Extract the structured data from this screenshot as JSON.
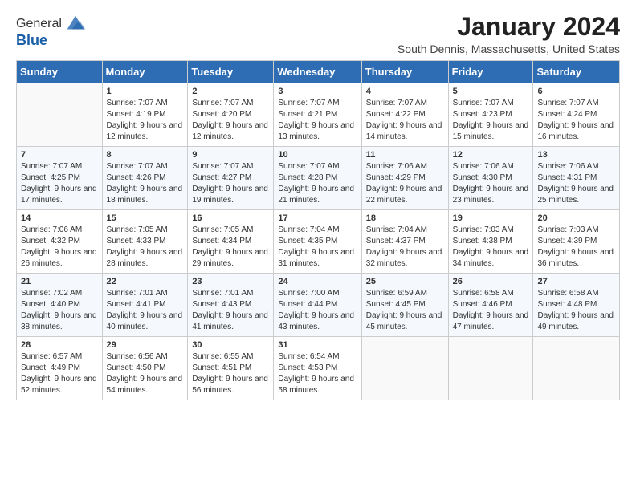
{
  "header": {
    "logo_line1": "General",
    "logo_line2": "Blue",
    "month_year": "January 2024",
    "location": "South Dennis, Massachusetts, United States"
  },
  "weekdays": [
    "Sunday",
    "Monday",
    "Tuesday",
    "Wednesday",
    "Thursday",
    "Friday",
    "Saturday"
  ],
  "weeks": [
    [
      {
        "day": "",
        "sunrise": "",
        "sunset": "",
        "daylight": ""
      },
      {
        "day": "1",
        "sunrise": "Sunrise: 7:07 AM",
        "sunset": "Sunset: 4:19 PM",
        "daylight": "Daylight: 9 hours and 12 minutes."
      },
      {
        "day": "2",
        "sunrise": "Sunrise: 7:07 AM",
        "sunset": "Sunset: 4:20 PM",
        "daylight": "Daylight: 9 hours and 12 minutes."
      },
      {
        "day": "3",
        "sunrise": "Sunrise: 7:07 AM",
        "sunset": "Sunset: 4:21 PM",
        "daylight": "Daylight: 9 hours and 13 minutes."
      },
      {
        "day": "4",
        "sunrise": "Sunrise: 7:07 AM",
        "sunset": "Sunset: 4:22 PM",
        "daylight": "Daylight: 9 hours and 14 minutes."
      },
      {
        "day": "5",
        "sunrise": "Sunrise: 7:07 AM",
        "sunset": "Sunset: 4:23 PM",
        "daylight": "Daylight: 9 hours and 15 minutes."
      },
      {
        "day": "6",
        "sunrise": "Sunrise: 7:07 AM",
        "sunset": "Sunset: 4:24 PM",
        "daylight": "Daylight: 9 hours and 16 minutes."
      }
    ],
    [
      {
        "day": "7",
        "sunrise": "Sunrise: 7:07 AM",
        "sunset": "Sunset: 4:25 PM",
        "daylight": "Daylight: 9 hours and 17 minutes."
      },
      {
        "day": "8",
        "sunrise": "Sunrise: 7:07 AM",
        "sunset": "Sunset: 4:26 PM",
        "daylight": "Daylight: 9 hours and 18 minutes."
      },
      {
        "day": "9",
        "sunrise": "Sunrise: 7:07 AM",
        "sunset": "Sunset: 4:27 PM",
        "daylight": "Daylight: 9 hours and 19 minutes."
      },
      {
        "day": "10",
        "sunrise": "Sunrise: 7:07 AM",
        "sunset": "Sunset: 4:28 PM",
        "daylight": "Daylight: 9 hours and 21 minutes."
      },
      {
        "day": "11",
        "sunrise": "Sunrise: 7:06 AM",
        "sunset": "Sunset: 4:29 PM",
        "daylight": "Daylight: 9 hours and 22 minutes."
      },
      {
        "day": "12",
        "sunrise": "Sunrise: 7:06 AM",
        "sunset": "Sunset: 4:30 PM",
        "daylight": "Daylight: 9 hours and 23 minutes."
      },
      {
        "day": "13",
        "sunrise": "Sunrise: 7:06 AM",
        "sunset": "Sunset: 4:31 PM",
        "daylight": "Daylight: 9 hours and 25 minutes."
      }
    ],
    [
      {
        "day": "14",
        "sunrise": "Sunrise: 7:06 AM",
        "sunset": "Sunset: 4:32 PM",
        "daylight": "Daylight: 9 hours and 26 minutes."
      },
      {
        "day": "15",
        "sunrise": "Sunrise: 7:05 AM",
        "sunset": "Sunset: 4:33 PM",
        "daylight": "Daylight: 9 hours and 28 minutes."
      },
      {
        "day": "16",
        "sunrise": "Sunrise: 7:05 AM",
        "sunset": "Sunset: 4:34 PM",
        "daylight": "Daylight: 9 hours and 29 minutes."
      },
      {
        "day": "17",
        "sunrise": "Sunrise: 7:04 AM",
        "sunset": "Sunset: 4:35 PM",
        "daylight": "Daylight: 9 hours and 31 minutes."
      },
      {
        "day": "18",
        "sunrise": "Sunrise: 7:04 AM",
        "sunset": "Sunset: 4:37 PM",
        "daylight": "Daylight: 9 hours and 32 minutes."
      },
      {
        "day": "19",
        "sunrise": "Sunrise: 7:03 AM",
        "sunset": "Sunset: 4:38 PM",
        "daylight": "Daylight: 9 hours and 34 minutes."
      },
      {
        "day": "20",
        "sunrise": "Sunrise: 7:03 AM",
        "sunset": "Sunset: 4:39 PM",
        "daylight": "Daylight: 9 hours and 36 minutes."
      }
    ],
    [
      {
        "day": "21",
        "sunrise": "Sunrise: 7:02 AM",
        "sunset": "Sunset: 4:40 PM",
        "daylight": "Daylight: 9 hours and 38 minutes."
      },
      {
        "day": "22",
        "sunrise": "Sunrise: 7:01 AM",
        "sunset": "Sunset: 4:41 PM",
        "daylight": "Daylight: 9 hours and 40 minutes."
      },
      {
        "day": "23",
        "sunrise": "Sunrise: 7:01 AM",
        "sunset": "Sunset: 4:43 PM",
        "daylight": "Daylight: 9 hours and 41 minutes."
      },
      {
        "day": "24",
        "sunrise": "Sunrise: 7:00 AM",
        "sunset": "Sunset: 4:44 PM",
        "daylight": "Daylight: 9 hours and 43 minutes."
      },
      {
        "day": "25",
        "sunrise": "Sunrise: 6:59 AM",
        "sunset": "Sunset: 4:45 PM",
        "daylight": "Daylight: 9 hours and 45 minutes."
      },
      {
        "day": "26",
        "sunrise": "Sunrise: 6:58 AM",
        "sunset": "Sunset: 4:46 PM",
        "daylight": "Daylight: 9 hours and 47 minutes."
      },
      {
        "day": "27",
        "sunrise": "Sunrise: 6:58 AM",
        "sunset": "Sunset: 4:48 PM",
        "daylight": "Daylight: 9 hours and 49 minutes."
      }
    ],
    [
      {
        "day": "28",
        "sunrise": "Sunrise: 6:57 AM",
        "sunset": "Sunset: 4:49 PM",
        "daylight": "Daylight: 9 hours and 52 minutes."
      },
      {
        "day": "29",
        "sunrise": "Sunrise: 6:56 AM",
        "sunset": "Sunset: 4:50 PM",
        "daylight": "Daylight: 9 hours and 54 minutes."
      },
      {
        "day": "30",
        "sunrise": "Sunrise: 6:55 AM",
        "sunset": "Sunset: 4:51 PM",
        "daylight": "Daylight: 9 hours and 56 minutes."
      },
      {
        "day": "31",
        "sunrise": "Sunrise: 6:54 AM",
        "sunset": "Sunset: 4:53 PM",
        "daylight": "Daylight: 9 hours and 58 minutes."
      },
      {
        "day": "",
        "sunrise": "",
        "sunset": "",
        "daylight": ""
      },
      {
        "day": "",
        "sunrise": "",
        "sunset": "",
        "daylight": ""
      },
      {
        "day": "",
        "sunrise": "",
        "sunset": "",
        "daylight": ""
      }
    ]
  ]
}
